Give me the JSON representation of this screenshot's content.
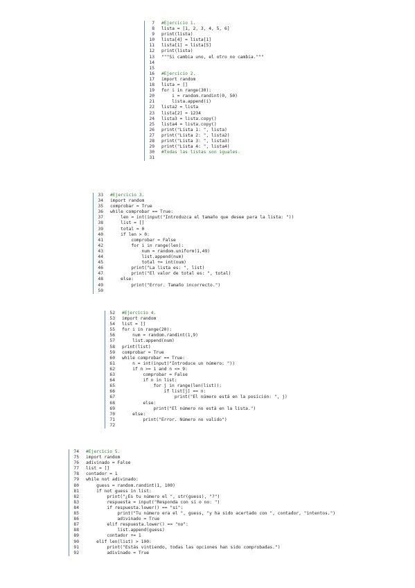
{
  "blocks": [
    {
      "id": "b1",
      "lines": [
        [
          "7",
          "#Ejercicio 1."
        ],
        [
          "8",
          "lista = [1, 2, 3, 4, 5, 6]"
        ],
        [
          "9",
          "print(lista)"
        ],
        [
          "10",
          "lista[4] = lista[1]"
        ],
        [
          "11",
          "lista[1] = lista[5]"
        ],
        [
          "12",
          "print(lista)"
        ],
        [
          "13",
          "\"\"\"Si cambia uno, el otro no cambia.\"\"\""
        ],
        [
          "14",
          ""
        ],
        [
          "15",
          ""
        ],
        [
          "16",
          "#Ejercicio 2."
        ],
        [
          "17",
          "import random"
        ],
        [
          "18",
          "lista = []"
        ],
        [
          "19",
          "for i in range(30):"
        ],
        [
          "20",
          "    i = random.randint(0, 50)"
        ],
        [
          "21",
          "    lista.append(i)"
        ],
        [
          "22",
          "lista2 = lista"
        ],
        [
          "23",
          "lista[2] = 1234"
        ],
        [
          "24",
          "lista3 = lista.copy()"
        ],
        [
          "25",
          "lista4 = lista.copy()"
        ],
        [
          "26",
          "print(\"Lista 1: \", lista)"
        ],
        [
          "27",
          "print(\"Lista 2: \", lista2)"
        ],
        [
          "28",
          "print(\"Lista 3: \", lista3)"
        ],
        [
          "29",
          "print(\"Lista 4: \", lista4)"
        ],
        [
          "30",
          "#Todas las listas son iguales."
        ],
        [
          "31",
          ""
        ]
      ]
    },
    {
      "id": "b2",
      "lines": [
        [
          "33",
          "#Ejercicio 3."
        ],
        [
          "34",
          "import random"
        ],
        [
          "35",
          "comprobar = True"
        ],
        [
          "36",
          "while comprobar == True:"
        ],
        [
          "37",
          "    len = int(input(\"Introduzca el tamaño que desee para la lista: \"))"
        ],
        [
          "38",
          "    list = []"
        ],
        [
          "39",
          "    total = 0"
        ],
        [
          "40",
          "    if len > 0:"
        ],
        [
          "41",
          "        comprobar = False"
        ],
        [
          "42",
          "        for i in range(len):"
        ],
        [
          "43",
          "            num = random.uniform(1,49)"
        ],
        [
          "44",
          "            list.append(num)"
        ],
        [
          "45",
          "            total += int(num)"
        ],
        [
          "46",
          "        print(\"La lista es: \", list)"
        ],
        [
          "47",
          "        print(\"El valor de total es: \", total)"
        ],
        [
          "48",
          "    else:"
        ],
        [
          "49",
          "        print(\"Error. Tamaño incorrecto.\")"
        ],
        [
          "50",
          ""
        ]
      ]
    },
    {
      "id": "b3",
      "lines": [
        [
          "52",
          "#Ejercicio 4."
        ],
        [
          "53",
          "import random"
        ],
        [
          "54",
          "list = []"
        ],
        [
          "55",
          "for i in range(20):"
        ],
        [
          "56",
          "    num = random.randint(1,9)"
        ],
        [
          "57",
          "    list.append(num)"
        ],
        [
          "58",
          "print(list)"
        ],
        [
          "59",
          "comprobar = True"
        ],
        [
          "60",
          "while comprobar == True:"
        ],
        [
          "61",
          "    n = int(input(\"Introduce un número: \"))"
        ],
        [
          "62",
          "    if n >= 1 and n <= 9:"
        ],
        [
          "63",
          "        comprobar = False"
        ],
        [
          "64",
          "        if n in list:"
        ],
        [
          "65",
          "            for j in range(len(list)):"
        ],
        [
          "66",
          "                if list[j] == n:"
        ],
        [
          "67",
          "                    print(\"El número está en la posición: \", j)"
        ],
        [
          "68",
          "        else:"
        ],
        [
          "69",
          "            print(\"El número no está en la lista.\")"
        ],
        [
          "70",
          "    else:"
        ],
        [
          "71",
          "        print(\"Error. Número no valido\")"
        ],
        [
          "72",
          ""
        ]
      ]
    },
    {
      "id": "b4",
      "lines": [
        [
          "74",
          "#Ejercicio 5."
        ],
        [
          "75",
          "import random"
        ],
        [
          "76",
          "adivinado = False"
        ],
        [
          "77",
          "list = []"
        ],
        [
          "78",
          "contador = 1"
        ],
        [
          "79",
          "while not adivinado:"
        ],
        [
          "80",
          "    guess = random.randint(1, 100)"
        ],
        [
          "81",
          "    if not guess in list:"
        ],
        [
          "82",
          "        print(\"¿Es tu número el \", str(guess), \"?\")"
        ],
        [
          "83",
          "        respuesta = input(\"Responda con si o no: \")"
        ],
        [
          "84",
          "        if respuesta.lower() == \"si\":"
        ],
        [
          "85",
          "            print(\"Tu número era el \", guess, \"y ha sido acertado con \", contador, \"intentos.\")"
        ],
        [
          "86",
          "            adivinado = True"
        ],
        [
          "87",
          "        elif respuesta.lower() == \"no\":"
        ],
        [
          "88",
          "            list.append(guess)"
        ],
        [
          "89",
          "        contador += 1"
        ],
        [
          "90",
          "    elif len(list) > 100:"
        ],
        [
          "91",
          "        print(\"Estás vintiendo, todas las opciones han sido comprobadas.\")"
        ],
        [
          "92",
          "        adivinado = True"
        ]
      ]
    }
  ]
}
